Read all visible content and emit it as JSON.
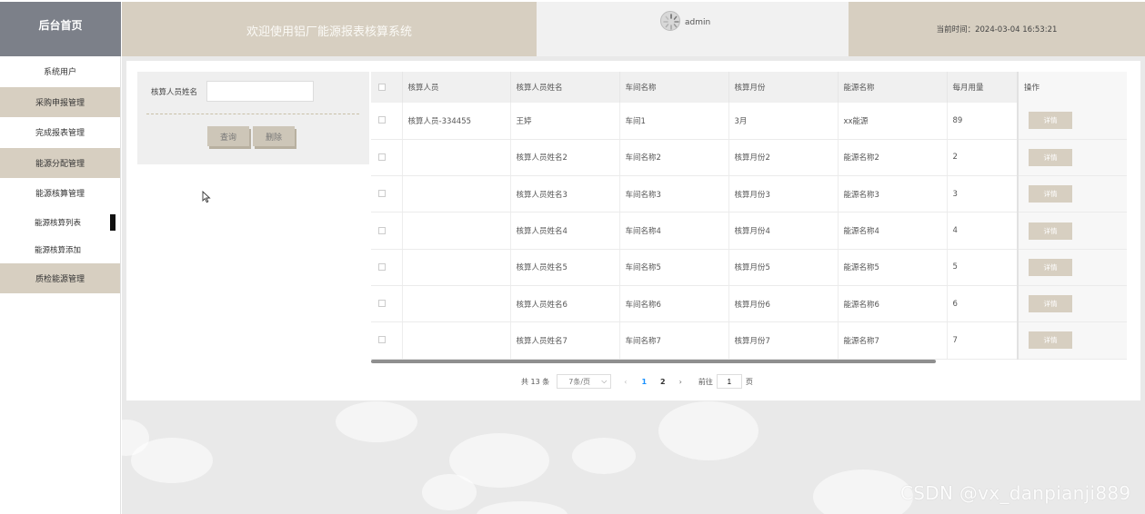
{
  "header": {
    "home_label": "后台首页",
    "system_title": "欢迎使用铝厂能源报表核算系统",
    "username": "admin",
    "time_label": "当前时间：2024-03-04 16:53:21"
  },
  "sidebar": {
    "items": [
      {
        "label": "系统用户"
      },
      {
        "label": "采购申报管理"
      },
      {
        "label": "完成报表管理"
      },
      {
        "label": "能源分配管理"
      },
      {
        "label": "能源核算管理"
      }
    ],
    "sub_items": [
      {
        "label": "能源核算列表"
      },
      {
        "label": "能源核算添加"
      }
    ],
    "last_item": {
      "label": "质检能源管理"
    }
  },
  "search": {
    "label": "核算人员姓名",
    "input_value": "",
    "query_label": "查询",
    "delete_label": "删除"
  },
  "table": {
    "headers": [
      "核算人员",
      "核算人员姓名",
      "车间名称",
      "核算月份",
      "能源名称",
      "每月用量",
      "操作"
    ],
    "rows": [
      [
        "核算人员-334455",
        "王婷",
        "车间1",
        "3月",
        "xx能源",
        "89"
      ],
      [
        "",
        "核算人员姓名2",
        "车间名称2",
        "核算月份2",
        "能源名称2",
        "2"
      ],
      [
        "",
        "核算人员姓名3",
        "车间名称3",
        "核算月份3",
        "能源名称3",
        "3"
      ],
      [
        "",
        "核算人员姓名4",
        "车间名称4",
        "核算月份4",
        "能源名称4",
        "4"
      ],
      [
        "",
        "核算人员姓名5",
        "车间名称5",
        "核算月份5",
        "能源名称5",
        "5"
      ],
      [
        "",
        "核算人员姓名6",
        "车间名称6",
        "核算月份6",
        "能源名称6",
        "6"
      ],
      [
        "",
        "核算人员姓名7",
        "车间名称7",
        "核算月份7",
        "能源名称7",
        "7"
      ]
    ],
    "detail_label": "详情"
  },
  "pagination": {
    "total": "共 13 条",
    "page_size": "7条/页",
    "pages": [
      "1",
      "2"
    ],
    "goto_label": "前往",
    "goto_value": "1",
    "page_unit": "页"
  },
  "watermark": "CSDN @vx_danpianji889",
  "colors": {
    "accent": "#d7cfc1",
    "home_bg": "#7c8089",
    "active_page": "#1890ff"
  }
}
